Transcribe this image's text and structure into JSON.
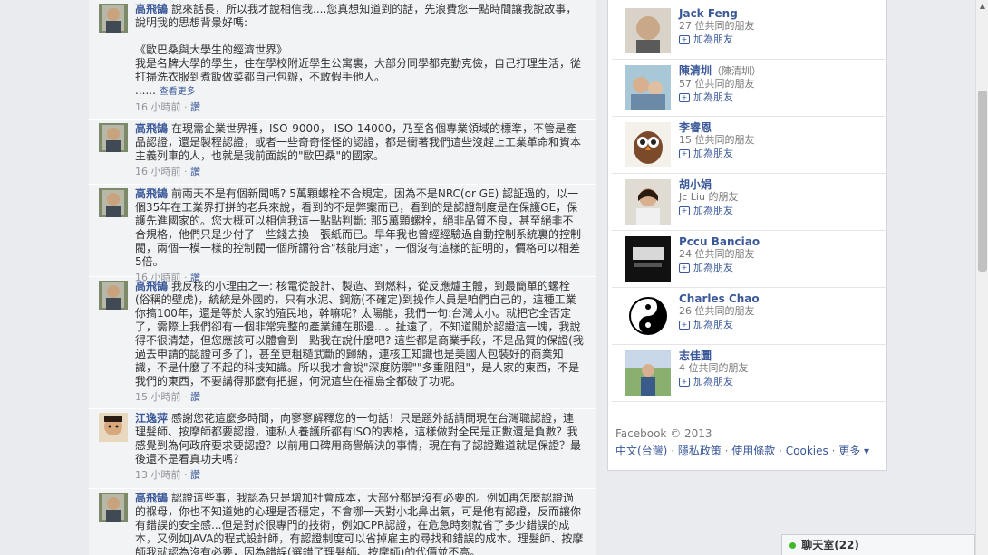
{
  "comments": [
    {
      "author": "高飛鵠",
      "text": "說來話長，所以我才說相信我....您真想知道到的話，先浪費您一點時間讓我說故事，說明我的思想背景好嗎:\n\n《歐巴桑與大學生的經濟世界》\n我是名牌大學的學生，住在學校附近學生公寓裏，大部分同學都克勤克儉，自己打理生活，從打掃洗衣服到煮飯做菜都自己包辦，不敢假手他人。\n......",
      "more": "查看更多",
      "time": "16 小時前",
      "like": "讚"
    },
    {
      "author": "高飛鵠",
      "text": "在現需企業世界裡，ISO-9000， ISO-14000，乃至各個專業領域的標準，不管是產品認證，還是製程認證，或者一些奇奇怪怪的認證，都是衝著我們這些沒趕上工業革命和資本主義列車的人，也就是我前面說的\"歐巴桑\"的國家。",
      "time": "16 小時前",
      "like": "讚"
    },
    {
      "author": "高飛鵠",
      "text": "前兩天不是有個新聞嗎? 5萬顆螺栓不合規定，因為不是NRC(or GE) 認証過的，以一個35年在工業界打拼的老兵來說，看到的不是弊案而已，看到的是認證制度是在保護GE，保護先進國家的。您大概可以相信我這一點點判斷: 那5萬顆螺栓，絕非品質不良，甚至絕非不合規格，他們只是少付了一些錢去換一張紙而已。早年我也曾經經驗過自動控制系統裏的控制閥，兩個一模一樣的控制閥一個所謂符合\"核能用途\"，一個沒有這樣的証明的，價格可以相差5倍。",
      "time": "16 小時前",
      "like": "讚"
    },
    {
      "author": "高飛鵠",
      "text": "我反核的小理由之一: 核電從設計、製造、到燃料，從反應爐主體，到最簡單的螺栓(俗稱的壁虎)，統統是外國的，只有水泥、鋼筋(不確定)到操作人員是咱們自己的，這種工業你搞100年，還是等於人家的殖民地，幹嘛呢? 太陽能，我們一句:台灣太小。就把它全否定了，需際上我們卻有一個非常完整的產業鏈在那邊...。扯遠了，不知道關於認證這一塊，我說得不很清楚，但您應該可以體會到一點我在說什麼吧? 這些都是商業手段，不是品質的保證(我過去申請的認證可多了)，甚至更粗糙武斷的歸納，連核工知識也是美國人包裝好的商業知識，不是什麼了不起的科技知識。所以我才會說\"深度防禦\"\"多重阻阻\"，是人家的東西，不是我們的東西，不要講得那麼有把握，何況這些在福島全都破了功呢。",
      "time": "15 小時前",
      "like": "讚"
    },
    {
      "author": "江逸萍",
      "text": "感謝您花這麼多時間，向寥寥解釋您的一句話！只是題外話請問現在台灣職認證，連理髮師、按摩師都要認證，連私人養護所都有ISO的表格，這樣做對全民是正數還是負數？我感覺到為何政府要求要認證？以前用口碑用商譽解決的事情，現在有了認證難道就是保證？最後還不是看真功夫嗎？",
      "time": "13 小時前",
      "like": "讚"
    },
    {
      "author": "高飛鵠",
      "text": "認證這些事，我認為只是增加社會成本，大部分都是沒有必要的。例如再怎麼認證過的褓母，你也不知道她的心理是否穩定，不會哪一天對小北鼻出氣，可是他有認證，反而讓你有錯誤的安全感...但是對於很專門的技術，例如CPR認證，在危急時刻就省了多少錯誤的成本，又例如JAVA的程式設計師，有認證制度可以省掉雇主的尋找和錯誤的成本。理髮師、按摩師我就認為沒有必要，因為錯誤(選錯了理髮師、按摩師)的代價並不高。",
      "time": "",
      "like": ""
    }
  ],
  "friends": [
    {
      "name": "Jack Feng",
      "alias": "",
      "mutual": "27 位共同的朋友",
      "add": "加為朋友"
    },
    {
      "name": "陳清圳",
      "alias": "（陳清圳）",
      "mutual": "57 位共同的朋友",
      "add": "加為朋友"
    },
    {
      "name": "李睿恩",
      "alias": "",
      "mutual": "15 位共同的朋友",
      "add": "加為朋友"
    },
    {
      "name": "胡小娟",
      "alias": "",
      "mutual": "Jc Liu 的朋友",
      "add": "加為朋友"
    },
    {
      "name": "Pccu Banciao",
      "alias": "",
      "mutual": "24 位共同的朋友",
      "add": "加為朋友"
    },
    {
      "name": "Charles Chao",
      "alias": "",
      "mutual": "26 位共同的朋友",
      "add": "加為朋友"
    },
    {
      "name": "志佳圜",
      "alias": "",
      "mutual": "4 位共同的朋友",
      "add": "加為朋友"
    }
  ],
  "footer": {
    "copyright": "Facebook © 2013",
    "lang": "中文(台灣)",
    "privacy": "隱私政策",
    "terms": "使用條款",
    "cookies": "Cookies",
    "more": "更多 ▾",
    "sep": " · "
  },
  "chat": {
    "label": "聊天室",
    "count": "(22)"
  },
  "icons": {
    "add_friend": "add-friend-icon",
    "online": "online-dot-icon"
  },
  "colors": {
    "link": "#3b5998",
    "online": "#42b72a"
  }
}
